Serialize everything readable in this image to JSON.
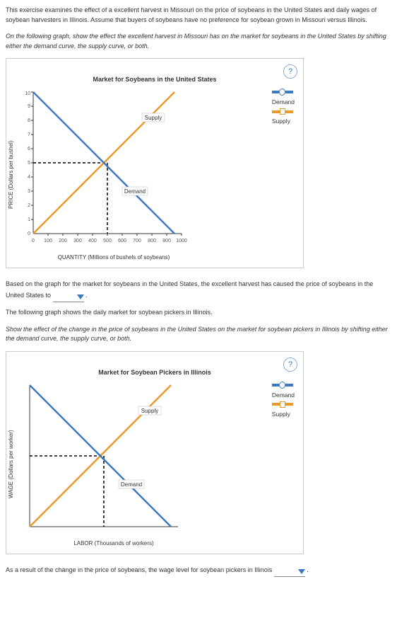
{
  "intro_text": "This exercise examines the effect of a excellent harvest in Missouri on the price of soybeans in the United States and daily wages of soybean harvesters in Illinois. Assume that buyers of soybeans have no preference for soybean grown in Missouri versus Illinois.",
  "instr1": "On the following graph, show the effect the excellent harvest in Missouri has on the market for soybeans in the United States by shifting either the demand curve, the supply curve, or both.",
  "help_label": "?",
  "graph1": {
    "title": "Market for Soybeans in the United States",
    "ylabel": "PRICE (Dollars per bushel)",
    "xlabel": "QUANTITY (Millions of bushels of soybeans)",
    "supply_label": "Supply",
    "demand_label": "Demand",
    "legend_demand": "Demand",
    "legend_supply": "Supply"
  },
  "between1_a": "Based on the graph for the market for soybeans in the United States, the excellent harvest has caused the price of soybeans in the United States to",
  "between1_b": ".",
  "between2": "The following graph shows the daily market for soybean pickers in Illinois.",
  "instr2": "Show the effect of the change in the price of soybeans in the United States on the market for soybean pickers in Illinois by shifting either the demand curve, the supply curve, or both.",
  "graph2": {
    "title": "Market for Soybean Pickers in Illinois",
    "ylabel": "WAGE (Dollars per worker)",
    "xlabel": "LABOR (Thousands of workers)",
    "supply_label": "Supply",
    "demand_label": "Demand",
    "legend_demand": "Demand",
    "legend_supply": "Supply"
  },
  "final_a": "As a result of the change in the price of soybeans, the wage level for soybean pickers in Illinois",
  "final_b": ".",
  "chart_data": [
    {
      "type": "line",
      "title": "Market for Soybeans in the United States",
      "xlabel": "QUANTITY (Millions of bushels of soybeans)",
      "ylabel": "PRICE (Dollars per bushel)",
      "x_ticks": [
        0,
        100,
        200,
        300,
        400,
        500,
        600,
        700,
        800,
        900,
        1000
      ],
      "y_ticks": [
        0,
        1,
        2,
        3,
        4,
        5,
        6,
        7,
        8,
        9,
        10
      ],
      "xlim": [
        0,
        1000
      ],
      "ylim": [
        0,
        10
      ],
      "series": [
        {
          "name": "Supply",
          "x": [
            0,
            1000
          ],
          "y": [
            0,
            10
          ],
          "color": "#e89a2c"
        },
        {
          "name": "Demand",
          "x": [
            0,
            1000
          ],
          "y": [
            10,
            0
          ],
          "color": "#3a7abf"
        }
      ],
      "equilibrium": {
        "x": 500,
        "y": 5
      },
      "grid": false,
      "legend_position": "right"
    },
    {
      "type": "line",
      "title": "Market for Soybean Pickers in Illinois",
      "xlabel": "LABOR (Thousands of workers)",
      "ylabel": "WAGE (Dollars per worker)",
      "xlim": [
        0,
        10
      ],
      "ylim": [
        0,
        10
      ],
      "series": [
        {
          "name": "Supply",
          "x": [
            0,
            10
          ],
          "y": [
            0,
            10
          ],
          "color": "#e89a2c"
        },
        {
          "name": "Demand",
          "x": [
            0,
            10
          ],
          "y": [
            10,
            0
          ],
          "color": "#3a7abf"
        }
      ],
      "equilibrium": {
        "x": 5,
        "y": 5
      },
      "grid": false,
      "legend_position": "right"
    }
  ]
}
